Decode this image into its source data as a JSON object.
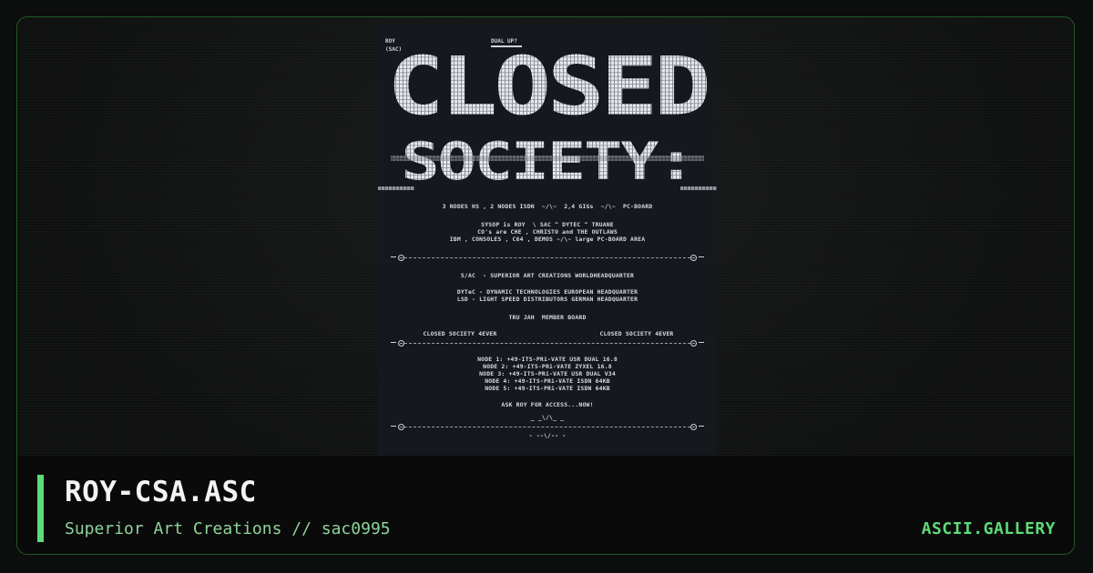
{
  "artwork": {
    "header_left": "ROY\n(SAC)",
    "header_center": "DUAL UP?",
    "logo_line1": "CLOSED",
    "logo_line2": "SOCIETY:",
    "lines": [
      "3 NODES HS , 2 NODES ISDN  ~/\\~  2,4 GIGs  ~/\\~  PC-BOARD",
      "SYSOP is ROY  \\ SAC ^ DYTEC ^ TRUANE",
      "CO's are CHE , CHRISTO and THE OUTLAWS",
      "IBM , CONSOLES , C64 , DEMOS ~/\\~ large PC-BOARD AREA",
      "S/AC  - SUPERIOR ART CREATIONS WORLDHEADQUARTER",
      "DYTeC - DYNAMIC TECHNOLOGIES EUROPEAN HEADQUARTER",
      "LSD - LIGHT SPEED DISTRIBUTORS GERMAN HEADQUARTER",
      "TRU JAH  MEMBER BOARD",
      "CLOSED SOCIETY 4EVER",
      "CLOSED SOCIETY 4EVER",
      "NODE 1: +49-ITS-PRi-VATE USR DUAL 16.8",
      "NODE 2: +49-ITS-PRi-VATE ZYXEL 16.8",
      "NODE 3: +49-ITS-PRi-VATE USR DUAL V34",
      "NODE 4: +49-ITS-PRi-VATE ISDN 64KB",
      "NODE 5: +49-ITS-PRi-VATE ISDN 64KB",
      "ASK ROY FOR ACCESS...NOW!",
      "_ _\\/\\_ _",
      "- --\\/-- -"
    ]
  },
  "caption": {
    "title": "ROY-CSA.ASC",
    "subtitle": "Superior Art Creations // sac0995",
    "brand": "ASCII.GALLERY"
  },
  "colors": {
    "accent": "#5ddb78",
    "frame_border": "#1f5a2a",
    "background": "#0c0d0d"
  }
}
